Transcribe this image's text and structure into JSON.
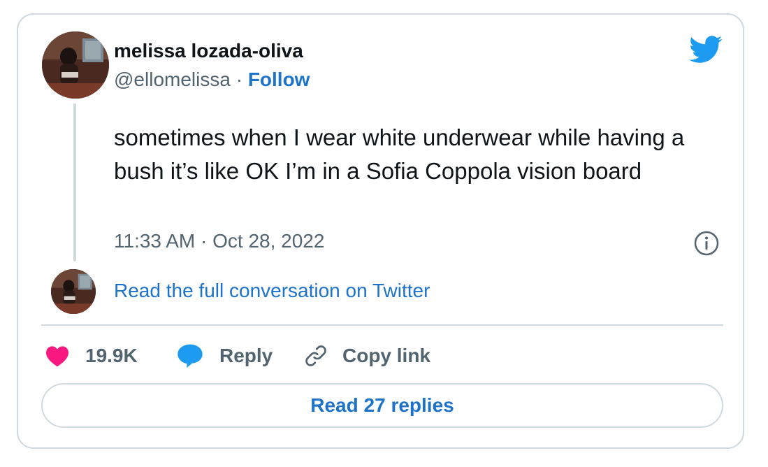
{
  "author": {
    "name": "melissa lozada-oliva",
    "handle": "@ellomelissa",
    "separator": " · ",
    "follow_label": "Follow"
  },
  "tweet": {
    "text": "sometimes when I wear white underwear while having a bush it’s like OK I’m in a Sofia Coppola vision board",
    "timestamp": "11:33 AM · Oct 28, 2022"
  },
  "conversation": {
    "link_label": "Read the full conversation on Twitter"
  },
  "actions": {
    "like_count": "19.9K",
    "reply_label": "Reply",
    "copy_link_label": "Copy link"
  },
  "replies_button": {
    "label": "Read 27 replies"
  },
  "icons": {
    "brand": "twitter-bird-icon",
    "info": "info-icon",
    "like": "heart-icon",
    "reply": "speech-bubble-icon",
    "copy": "link-icon"
  },
  "colors": {
    "twitter_blue": "#1d9bf0",
    "link_blue": "#1d72c9",
    "heart_pink": "#f91880",
    "muted_text": "#536471",
    "border": "#cfd9de"
  }
}
